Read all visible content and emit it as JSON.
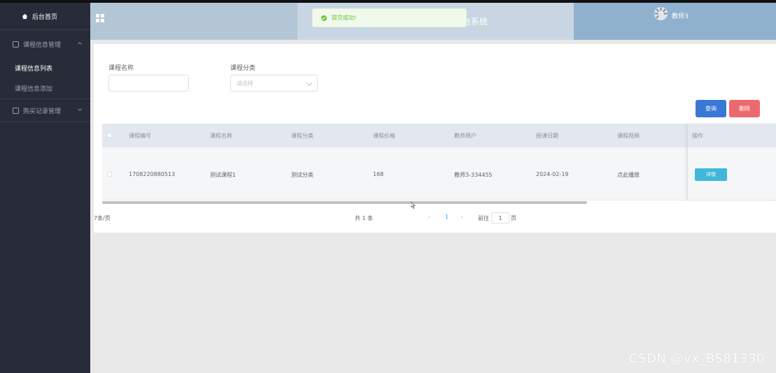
{
  "sidebar": {
    "home_label": "后台首页",
    "groups": [
      {
        "label": "课程信息管理",
        "items": [
          {
            "label": "课程信息列表",
            "active": true
          },
          {
            "label": "课程信息添加",
            "active": false
          }
        ]
      },
      {
        "label": "购买记录管理",
        "items": []
      }
    ]
  },
  "header": {
    "title": "台系统",
    "user": "教师3"
  },
  "toast": {
    "message": "提交成功!"
  },
  "search": {
    "name_label": "课程名称",
    "name_value": "",
    "category_label": "课程分类",
    "category_placeholder": "请选择"
  },
  "buttons": {
    "query": "查询",
    "delete": "删除"
  },
  "table": {
    "headers": [
      "课程编号",
      "课程名称",
      "课程分类",
      "课程价格",
      "教师用户",
      "授课日期",
      "课程视频",
      "操作"
    ],
    "rows": [
      {
        "code": "1708220880513",
        "name": "测试课程1",
        "category": "测试分类",
        "price": "168",
        "teacher": "教师3-334455",
        "date": "2024-02-19",
        "video": "点此播放",
        "action": "详情"
      }
    ],
    "scroll_fraction": 0.72
  },
  "pagination": {
    "total": "共 1 条",
    "page_size": "7条/页",
    "current_page": "1",
    "goto_label": "前往",
    "goto_value": "1",
    "page_suffix": "页"
  },
  "watermark": "CSDN @vx_BS81330",
  "colors": {
    "sidebar_bg": "#272c38",
    "header_bg": "#b3c6d6",
    "query_btn": "#3a78d6",
    "delete_btn": "#ec6a6f",
    "detail_btn": "#3fb8da",
    "success": "#67c23a"
  },
  "icons": [
    "home-icon",
    "folder-icon",
    "chevron-up-icon",
    "chevron-down-icon",
    "grid-menu-icon",
    "avatar-icon",
    "success-check-icon",
    "select-arrow-icon",
    "prev-icon",
    "next-icon"
  ]
}
